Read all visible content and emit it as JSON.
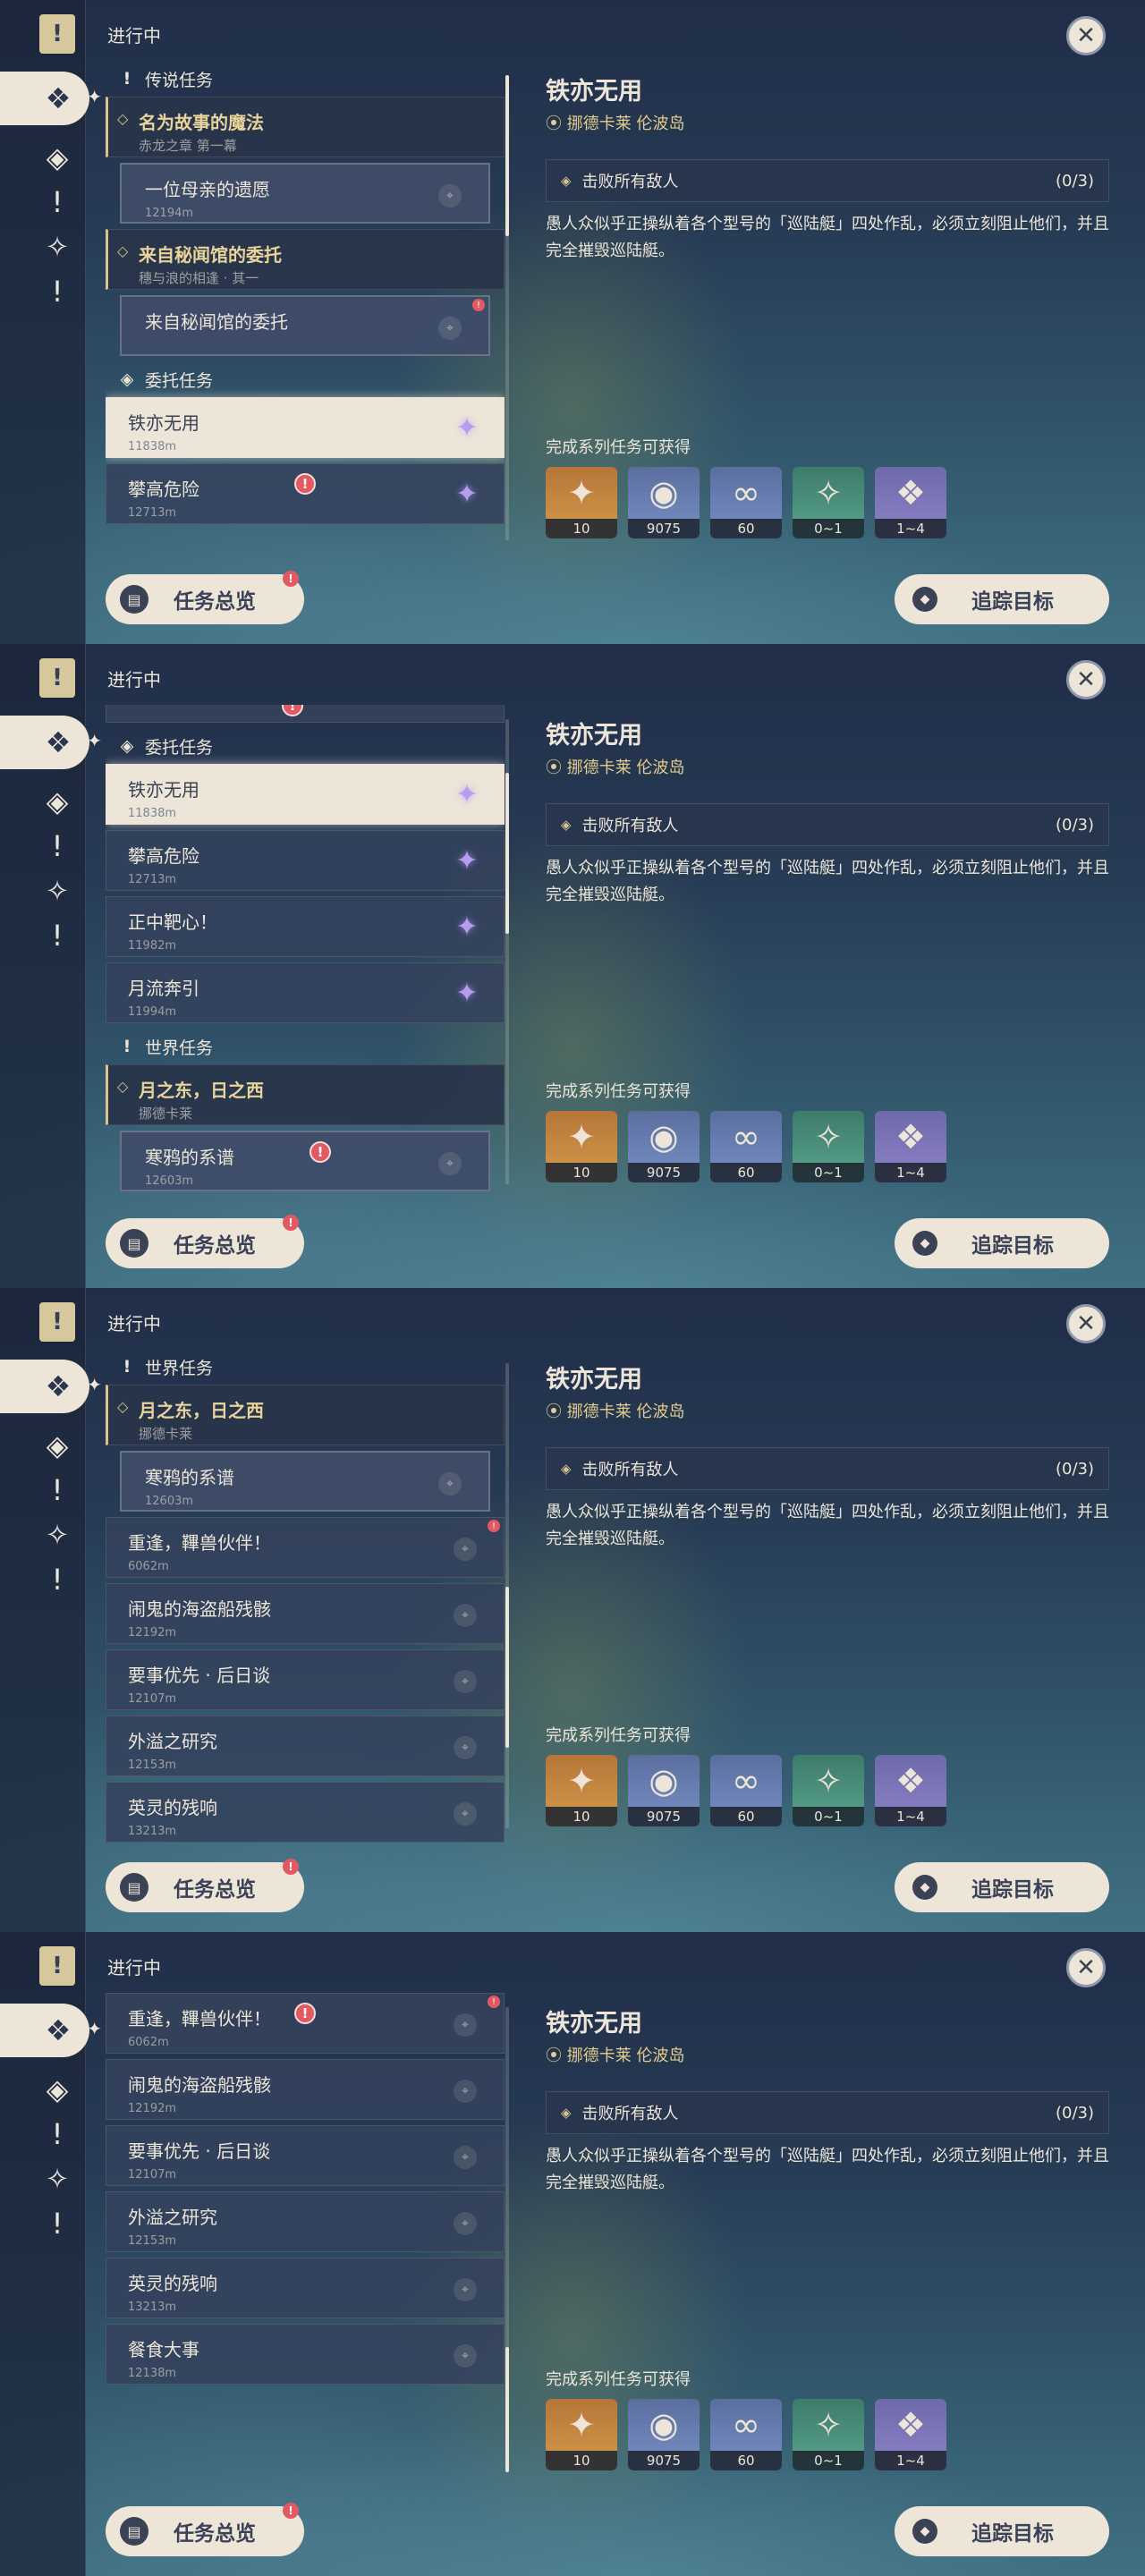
{
  "status_label": "进行中",
  "rail_icons": [
    "quest-book-icon",
    "commission-icon",
    "archon-icon",
    "legend-icon",
    "world-icon",
    "event-icon"
  ],
  "sections": {
    "legend": "传说任务",
    "commission": "委托任务",
    "world": "世界任务"
  },
  "chapters": {
    "magic": {
      "title": "名为故事的魔法",
      "sub": "赤龙之章 第一幕"
    },
    "secret": {
      "title": "来自秘闻馆的委托",
      "sub": "穗与浪的相逢 · 其一"
    },
    "moon": {
      "title": "月之东，日之西",
      "sub": "挪德卡莱"
    }
  },
  "quests": {
    "mother": {
      "title": "一位母亲的遗愿",
      "dist": "12194m"
    },
    "secret_sub": {
      "title": "来自秘闻馆的委托",
      "dist": ""
    },
    "iron": {
      "title": "铁亦无用",
      "dist": "11838m"
    },
    "climb": {
      "title": "攀高危险",
      "dist": "12713m"
    },
    "bullseye": {
      "title": "正中靶心！",
      "dist": "11982m"
    },
    "moonflow": {
      "title": "月流奔引",
      "dist": "11994m"
    },
    "raven": {
      "title": "寒鸦的系谱",
      "dist": "12603m"
    },
    "reunion": {
      "title": "重逢，鞸兽伙伴！",
      "dist": "6062m"
    },
    "pirate": {
      "title": "闹鬼的海盗船残骸",
      "dist": "12192m"
    },
    "priority": {
      "title": "要事优先 · 后日谈",
      "dist": "12107m"
    },
    "overflow": {
      "title": "外溢之研究",
      "dist": "12153m"
    },
    "heroic": {
      "title": "英灵的残响",
      "dist": "13213m"
    },
    "meal": {
      "title": "餐食大事",
      "dist": "12138m"
    }
  },
  "detail": {
    "title": "铁亦无用",
    "location": "挪德卡莱 伦波岛",
    "objective": "击败所有敌人",
    "progress": "(0/3)",
    "description": "愚人众似乎正操纵着各个型号的「巡陆艇」四处作乱，必须立刻阻止他们，并且完全摧毁巡陆艇。",
    "rewards_label": "完成系列任务可获得",
    "rewards": [
      {
        "icon": "primogem-icon",
        "count": "10",
        "tone": "gold"
      },
      {
        "icon": "mora-icon",
        "count": "9075",
        "tone": "blue"
      },
      {
        "icon": "exp-icon",
        "count": "60",
        "tone": "blue"
      },
      {
        "icon": "crystal-chunk-icon",
        "count": "0~1",
        "tone": "green"
      },
      {
        "icon": "crystal-cluster-icon",
        "count": "1~4",
        "tone": "purple"
      }
    ]
  },
  "buttons": {
    "overview": "任务总览",
    "track": "追踪目标"
  }
}
